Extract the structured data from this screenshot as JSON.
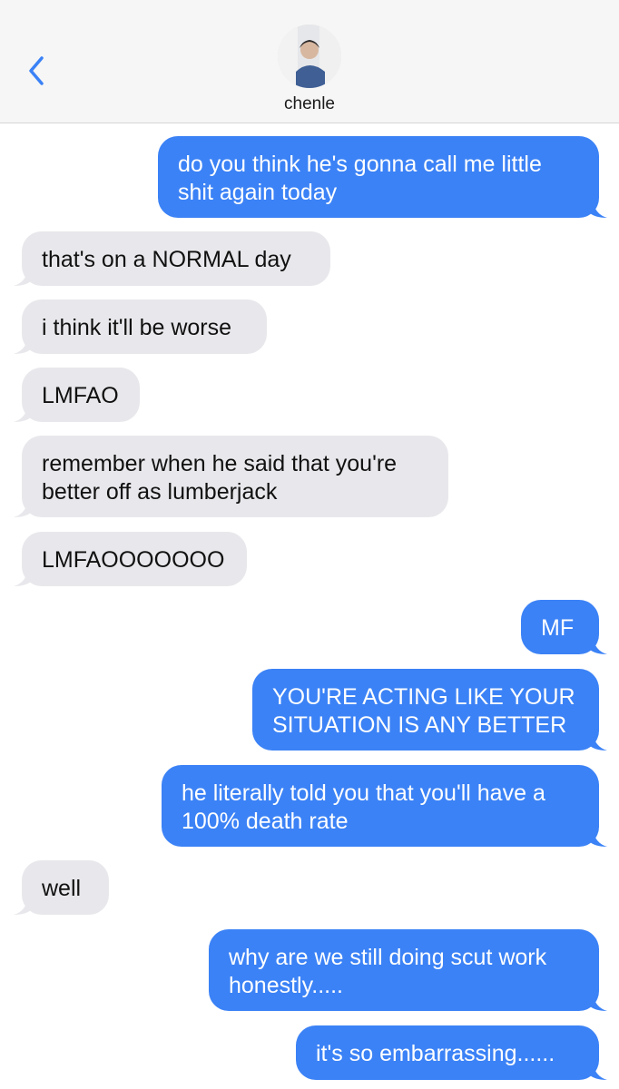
{
  "header": {
    "contact_name": "chenle",
    "back_icon": "chevron-left-icon",
    "colors": {
      "accent": "#3b82f6",
      "header_bg": "#f6f6f6"
    }
  },
  "messages": [
    {
      "direction": "out",
      "text": "do you think he's gonna call me little\nshit again today"
    },
    {
      "direction": "in",
      "text": "that's on a NORMAL day"
    },
    {
      "direction": "in",
      "text": "i think it'll be worse"
    },
    {
      "direction": "in",
      "text": "LMFAO"
    },
    {
      "direction": "in",
      "text": "remember when he said that you're\nbetter off as lumberjack"
    },
    {
      "direction": "in",
      "text": "LMFAOOOOOOO"
    },
    {
      "direction": "out",
      "text": "MF"
    },
    {
      "direction": "out",
      "text": "YOU'RE ACTING LIKE YOUR\nSITUATION IS ANY BETTER"
    },
    {
      "direction": "out",
      "text": "he literally told you that you'll have a\n100% death rate"
    },
    {
      "direction": "in",
      "text": "well"
    },
    {
      "direction": "out",
      "text": "why are we still doing scut work\nhonestly....."
    },
    {
      "direction": "out",
      "text": "it's so embarrassing......"
    }
  ]
}
